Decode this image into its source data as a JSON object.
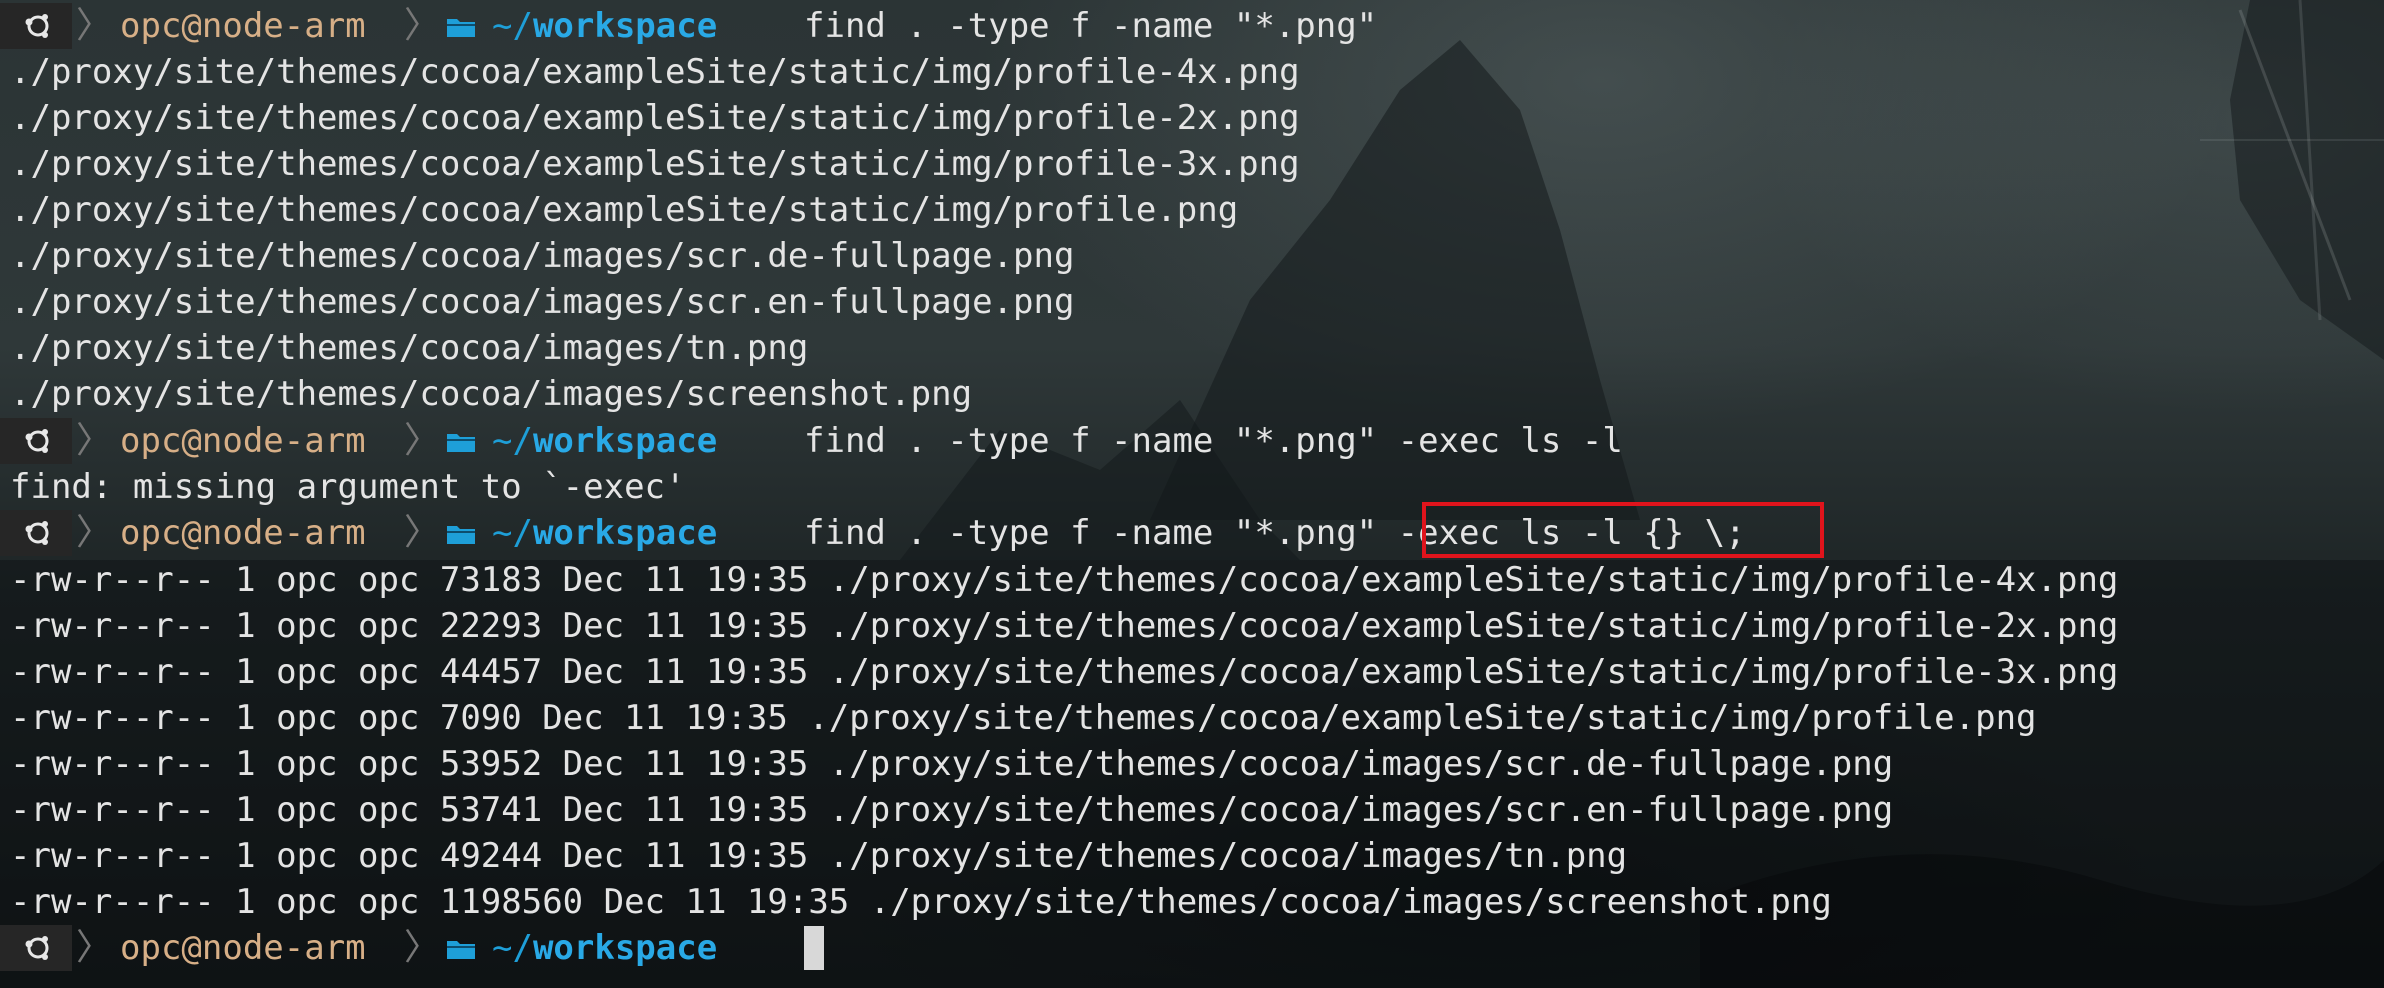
{
  "prompt": {
    "user_host": "opc@node-arm",
    "dir_tilde": "~/",
    "dir_name": "workspace"
  },
  "commands": {
    "cmd1": "find . -type f -name \"*.png\"",
    "cmd2": "find . -type f -name \"*.png\" -exec ls -l",
    "cmd3": "find . -type f -name \"*.png\" -exec ls -l {} \\;"
  },
  "output1": [
    "./proxy/site/themes/cocoa/exampleSite/static/img/profile-4x.png",
    "./proxy/site/themes/cocoa/exampleSite/static/img/profile-2x.png",
    "./proxy/site/themes/cocoa/exampleSite/static/img/profile-3x.png",
    "./proxy/site/themes/cocoa/exampleSite/static/img/profile.png",
    "./proxy/site/themes/cocoa/images/scr.de-fullpage.png",
    "./proxy/site/themes/cocoa/images/scr.en-fullpage.png",
    "./proxy/site/themes/cocoa/images/tn.png",
    "./proxy/site/themes/cocoa/images/screenshot.png"
  ],
  "error_line": "find: missing argument to `-exec'",
  "output3": [
    "-rw-r--r-- 1 opc opc 73183 Dec 11 19:35 ./proxy/site/themes/cocoa/exampleSite/static/img/profile-4x.png",
    "-rw-r--r-- 1 opc opc 22293 Dec 11 19:35 ./proxy/site/themes/cocoa/exampleSite/static/img/profile-2x.png",
    "-rw-r--r-- 1 opc opc 44457 Dec 11 19:35 ./proxy/site/themes/cocoa/exampleSite/static/img/profile-3x.png",
    "-rw-r--r-- 1 opc opc 7090 Dec 11 19:35 ./proxy/site/themes/cocoa/exampleSite/static/img/profile.png",
    "-rw-r--r-- 1 opc opc 53952 Dec 11 19:35 ./proxy/site/themes/cocoa/images/scr.de-fullpage.png",
    "-rw-r--r-- 1 opc opc 53741 Dec 11 19:35 ./proxy/site/themes/cocoa/images/scr.en-fullpage.png",
    "-rw-r--r-- 1 opc opc 49244 Dec 11 19:35 ./proxy/site/themes/cocoa/images/tn.png",
    "-rw-r--r-- 1 opc opc 1198560 Dec 11 19:35 ./proxy/site/themes/cocoa/images/screenshot.png"
  ],
  "colors": {
    "user_host": "#d7af87",
    "directory": "#29a9e6",
    "text": "#e4e4e4",
    "highlight_border": "#e0141c"
  },
  "icons": {
    "os": "os-logo-icon",
    "folder": "folder-icon"
  }
}
